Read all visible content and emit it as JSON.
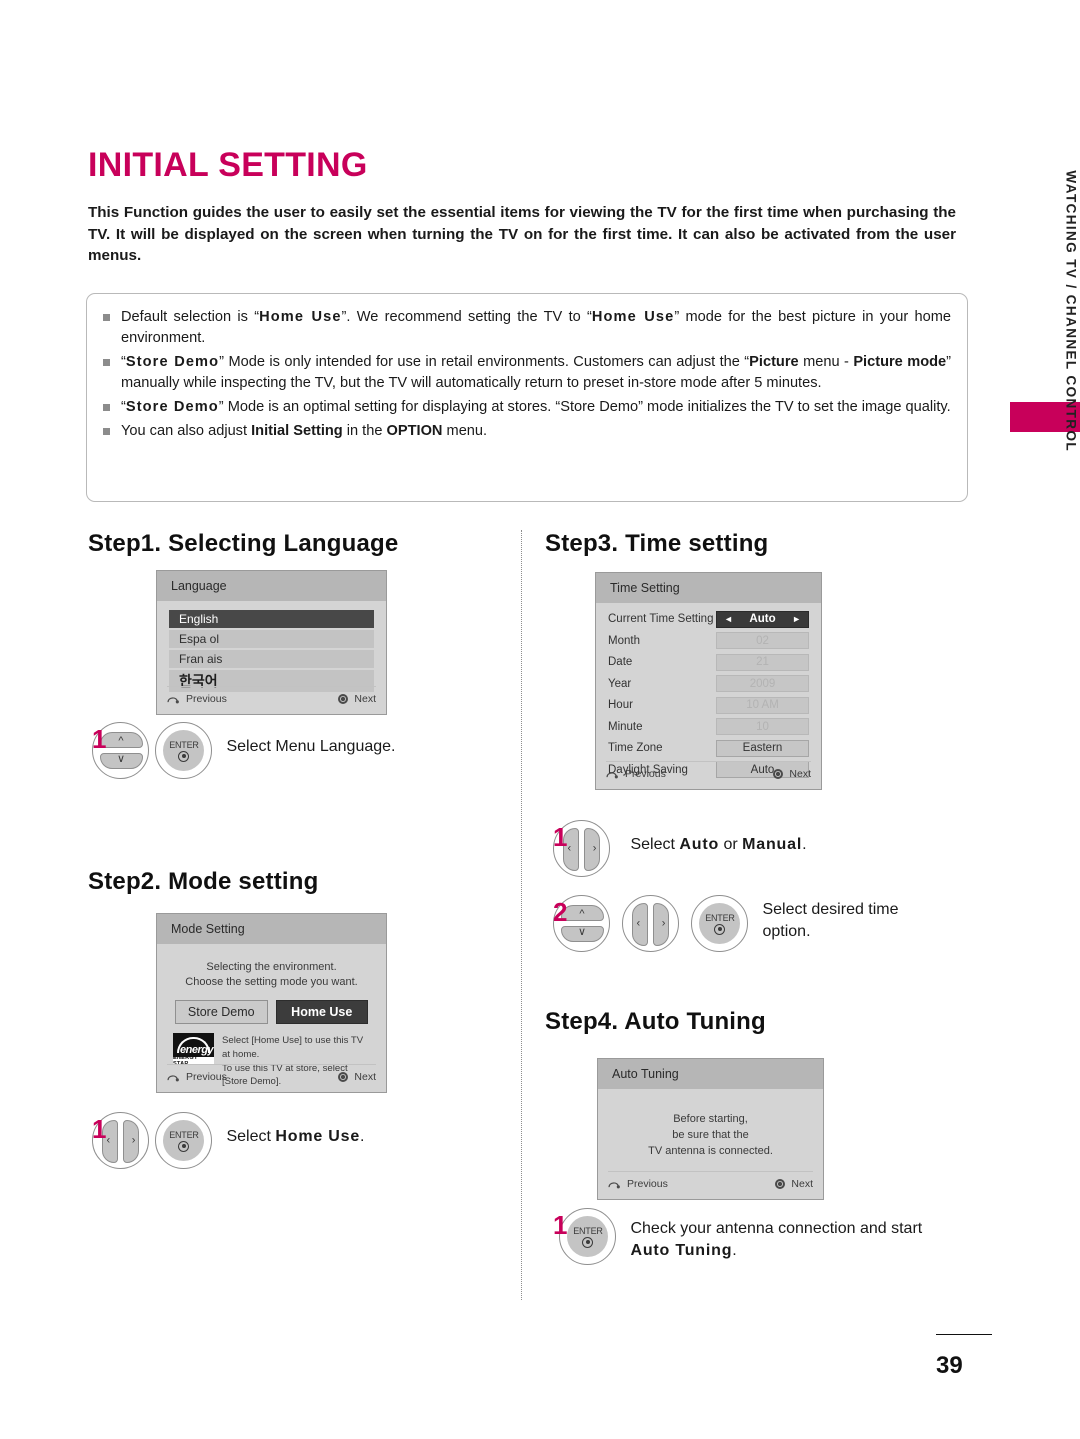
{
  "page": {
    "title": "INITIAL SETTING",
    "intro": "This Function guides the user to easily set the essential items for viewing the TV for the first time when purchasing the TV. It will be displayed on the screen when turning the TV on for the first time. It can also be activated from the user menus.",
    "number": "39",
    "accent_color": "#C8005A"
  },
  "side_tab": {
    "label": "WATCHING TV / CHANNEL CONTROL"
  },
  "notes": [
    {
      "parts": [
        {
          "t": "Default selection is “",
          "s": "n"
        },
        {
          "t": "Home Use",
          "s": "sp"
        },
        {
          "t": "”. We recommend setting the TV to “",
          "s": "n"
        },
        {
          "t": "Home Use",
          "s": "sp"
        },
        {
          "t": "” mode for the best picture in your home environment.",
          "s": "n"
        }
      ]
    },
    {
      "parts": [
        {
          "t": "“",
          "s": "n"
        },
        {
          "t": "Store Demo",
          "s": "sp"
        },
        {
          "t": "” Mode is only intended for use in retail environments. Customers can adjust the “",
          "s": "n"
        },
        {
          "t": "Picture",
          "s": "b"
        },
        {
          "t": " menu - ",
          "s": "n"
        },
        {
          "t": "Picture mode",
          "s": "b"
        },
        {
          "t": "” manually while inspecting the TV, but the TV will automatically return to preset in-store mode after 5 minutes.",
          "s": "n"
        }
      ]
    },
    {
      "parts": [
        {
          "t": "“",
          "s": "n"
        },
        {
          "t": "Store Demo",
          "s": "sp"
        },
        {
          "t": "” Mode is an optimal setting for displaying at stores. “Store Demo” mode initializes the TV to set the image quality.",
          "s": "n"
        }
      ]
    },
    {
      "parts": [
        {
          "t": "You can also adjust ",
          "s": "n"
        },
        {
          "t": "Initial Setting",
          "s": "b"
        },
        {
          "t": " in the ",
          "s": "n"
        },
        {
          "t": "OPTION",
          "s": "b"
        },
        {
          "t": " menu.",
          "s": "n"
        }
      ]
    }
  ],
  "steps": {
    "step1": {
      "heading": "Step1. Selecting Language",
      "osd": {
        "title": "Language",
        "options": [
          {
            "label": "English",
            "selected": true
          },
          {
            "label": "Espa ol",
            "selected": false
          },
          {
            "label": "Fran ais",
            "selected": false
          },
          {
            "label": "한국어",
            "selected": false
          }
        ],
        "previous": "Previous",
        "next": "Next"
      },
      "instruction": {
        "num": "1",
        "text": "Select Menu Language."
      }
    },
    "step2": {
      "heading": "Step2. Mode setting",
      "osd": {
        "title": "Mode Setting",
        "desc_line1": "Selecting the environment.",
        "desc_line2": "Choose the setting mode you want.",
        "buttons": [
          {
            "label": "Store Demo",
            "selected": false
          },
          {
            "label": "Home Use",
            "selected": true
          }
        ],
        "energy_star_label": "ENERGY STAR",
        "energy_star_mark": "energy",
        "hint_line1": "Select [Home Use] to use this TV at home.",
        "hint_line2": "To use this TV at store, select [Store Demo].",
        "previous": "Previous",
        "next": "Next"
      },
      "instruction": {
        "num": "1",
        "prefix": "Select ",
        "bold": "Home Use",
        "suffix": "."
      }
    },
    "step3": {
      "heading": "Step3. Time setting",
      "osd": {
        "title": "Time Setting",
        "rows": [
          {
            "label": "Current Time Setting",
            "value": "Auto",
            "state": "active"
          },
          {
            "label": "Month",
            "value": "02",
            "state": "dim"
          },
          {
            "label": "Date",
            "value": "21",
            "state": "dim"
          },
          {
            "label": "Year",
            "value": "2009",
            "state": "dim"
          },
          {
            "label": "Hour",
            "value": "10 AM",
            "state": "dim"
          },
          {
            "label": "Minute",
            "value": "10",
            "state": "dim"
          },
          {
            "label": "Time Zone",
            "value": "Eastern",
            "state": "normal"
          },
          {
            "label": "Daylight Saving",
            "value": "Auto",
            "state": "normal"
          }
        ],
        "arrow_left": "◄",
        "arrow_right": "►",
        "previous": "Previous",
        "next": "Next"
      },
      "instruction1": {
        "num": "1",
        "prefix": "Select ",
        "bold1": "Auto",
        "mid": " or ",
        "bold2": "Manual",
        "suffix": "."
      },
      "instruction2": {
        "num": "2",
        "line1": "Select desired time",
        "line2": "option."
      }
    },
    "step4": {
      "heading": "Step4. Auto Tuning",
      "osd": {
        "title": "Auto Tuning",
        "msg_line1": "Before starting,",
        "msg_line2": "be sure that the",
        "msg_line3": "TV antenna is connected.",
        "previous": "Previous",
        "next": "Next"
      },
      "instruction": {
        "num": "1",
        "line1": "Check your antenna connection and start",
        "bold": "Auto Tuning",
        "suffix": "."
      }
    }
  }
}
